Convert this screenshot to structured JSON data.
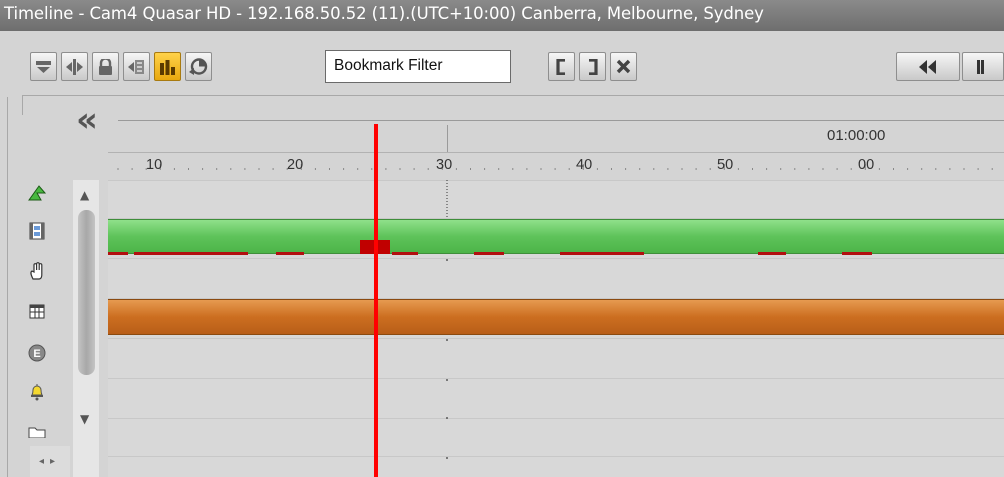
{
  "window": {
    "title": "Timeline - Cam4 Quasar HD - 192.168.50.52 (11).(UTC+10:00) Canberra, Melbourne, Sydney"
  },
  "toolbar": {
    "bookmark_filter_value": "Bookmark Filter",
    "buttons": [
      "collapse-icon",
      "split-icon",
      "lock-icon",
      "export-icon",
      "bar-chart-icon",
      "pie-chart-icon"
    ],
    "active_button": "bar-chart-icon",
    "accent_color": "#f0b820"
  },
  "ruler": {
    "ticks": [
      "10",
      "20",
      "30",
      "40",
      "50",
      "00"
    ],
    "hour_label": "01:00:00",
    "collapse_glyph": "«"
  },
  "sidebar": {
    "icons": [
      "motion-icon",
      "video-icon",
      "hand-icon",
      "table-icon",
      "event-icon",
      "alarm-icon",
      "folder-icon"
    ]
  },
  "tracks": {
    "video_color": "#5ec35a",
    "recording_color": "#cc6e20",
    "playhead_color": "#ff0000"
  }
}
